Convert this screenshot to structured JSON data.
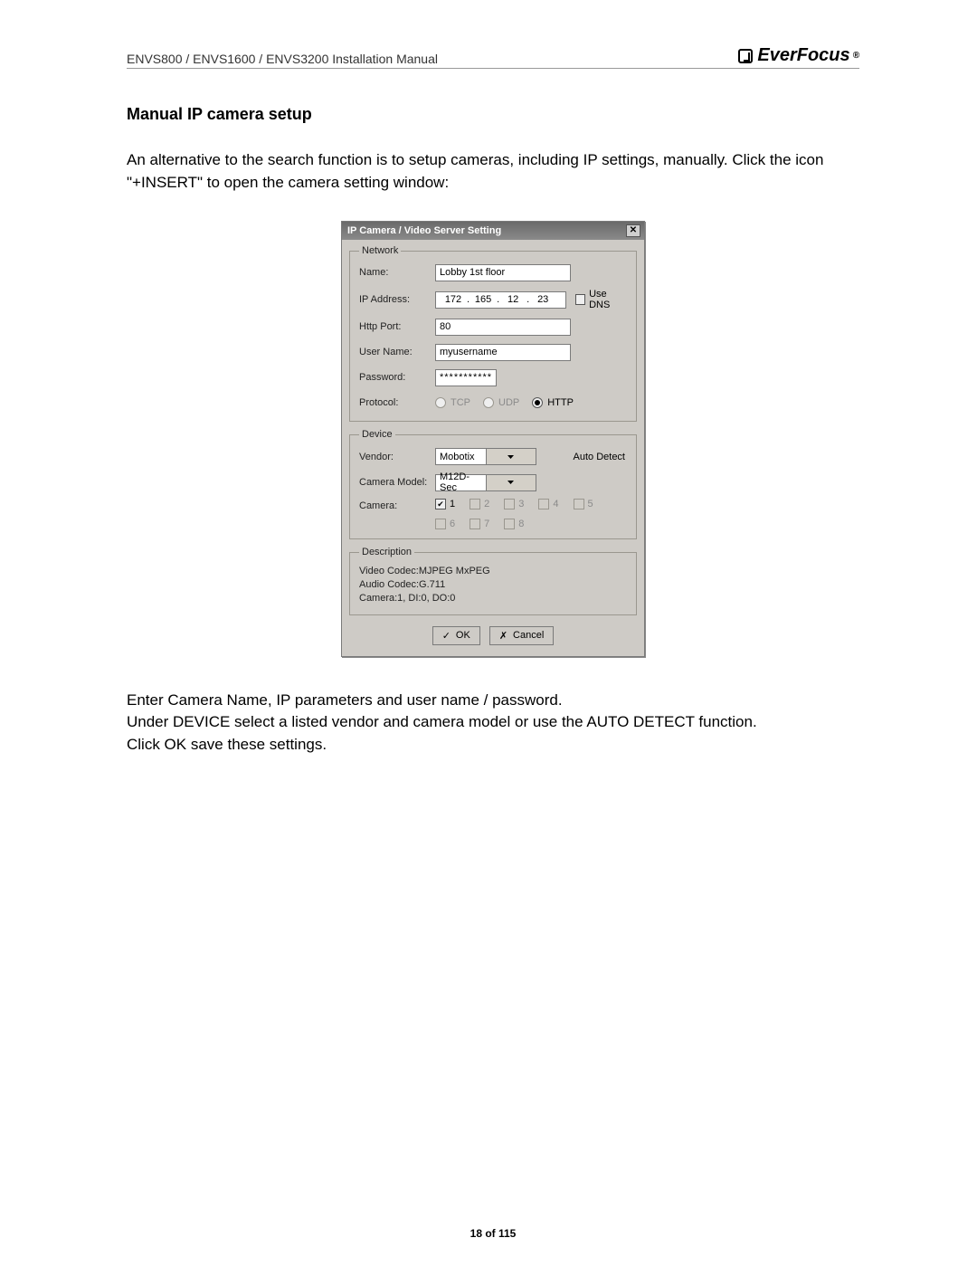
{
  "header": {
    "doc_title": "ENVS800 / ENVS1600 / ENVS3200 Installation Manual",
    "brand": "EverFocus"
  },
  "section_title": "Manual IP camera setup",
  "intro_text": "An alternative to the search function is to setup cameras, including IP settings, manually. Click the icon  \"+INSERT\" to open the camera setting window:",
  "dialog": {
    "title": "IP Camera / Video Server Setting",
    "network": {
      "legend": "Network",
      "labels": {
        "name": "Name:",
        "ip": "IP Address:",
        "port": "Http Port:",
        "user": "User Name:",
        "pass": "Password:",
        "protocol": "Protocol:"
      },
      "name_value": "Lobby 1st floor",
      "ip": {
        "a": "172",
        "b": "165",
        "c": "12",
        "d": "23"
      },
      "use_dns_label": "Use DNS",
      "port_value": "80",
      "user_value": "myusername",
      "pass_value": "*************",
      "protocols": {
        "tcp": "TCP",
        "udp": "UDP",
        "http": "HTTP"
      }
    },
    "device": {
      "legend": "Device",
      "labels": {
        "vendor": "Vendor:",
        "model": "Camera Model:",
        "camera": "Camera:"
      },
      "vendor_value": "Mobotix",
      "model_value": "M12D-Sec",
      "auto_detect": "Auto Detect",
      "cams": [
        "1",
        "2",
        "3",
        "4",
        "5",
        "6",
        "7",
        "8"
      ]
    },
    "description": {
      "legend": "Description",
      "line1": "Video Codec:MJPEG MxPEG",
      "line2": "Audio Codec:G.711",
      "line3": "Camera:1, DI:0, DO:0"
    },
    "buttons": {
      "ok": "OK",
      "cancel": "Cancel"
    }
  },
  "outro_text": "Enter Camera Name, IP parameters and user name / password.\nUnder DEVICE select a listed vendor and camera model or use the AUTO DETECT function.\nClick OK save these settings.",
  "page_footer": "18 of 115"
}
